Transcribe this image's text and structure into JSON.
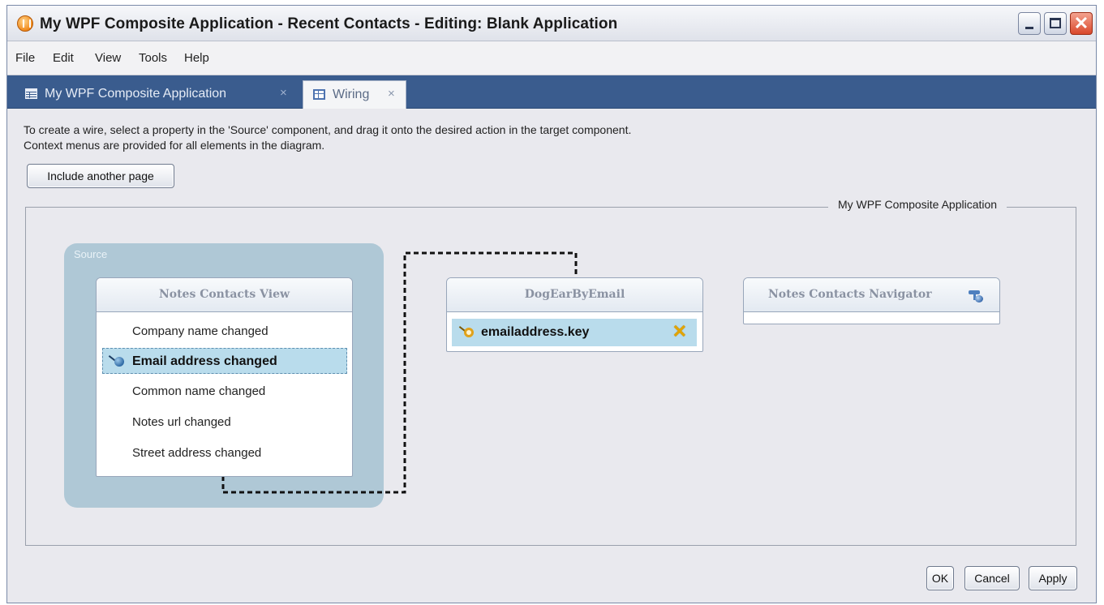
{
  "window": {
    "title": "My WPF Composite Application - Recent Contacts - Editing: Blank Application",
    "icon": "app-orb-icon",
    "controls": [
      "minimize",
      "maximize",
      "close"
    ]
  },
  "menu": {
    "items": [
      "File",
      "Edit",
      "View",
      "Tools",
      "Help"
    ]
  },
  "tabs": [
    {
      "label": "My WPF Composite Application",
      "close": "×",
      "icon": "table-icon",
      "active": false
    },
    {
      "label": "Wiring",
      "close": "×",
      "icon": "layout-icon",
      "active": true
    }
  ],
  "instructions": {
    "line1": "To create a wire, select a property in the 'Source' component, and drag it onto the desired action in the target component.",
    "line2": "Context menus are provided for all elements in the diagram."
  },
  "include_button": "Include another page",
  "diagram": {
    "group_label": "My WPF Composite Application",
    "source_label": "Source",
    "components": [
      {
        "title": "Notes Contacts View",
        "events": [
          {
            "label": "Company name changed",
            "selected": false
          },
          {
            "label": "Email address changed",
            "selected": true
          },
          {
            "label": "Common name changed",
            "selected": false
          },
          {
            "label": "Notes url changed",
            "selected": false
          },
          {
            "label": "Street address changed",
            "selected": false
          }
        ]
      },
      {
        "title": "DogEarByEmail",
        "actions": [
          {
            "label": "emailaddress.key",
            "remove_icon": "close-x-icon"
          }
        ]
      },
      {
        "title": "Notes Contacts Navigator",
        "icon": "navigator-icon",
        "actions": []
      }
    ]
  },
  "footer": {
    "ok": "OK",
    "cancel": "Cancel",
    "apply": "Apply"
  },
  "colors": {
    "tab_bar": "#3a5c8e",
    "source_area": "#afc8d6",
    "selected_row": "#b9dcec",
    "background": "#e9e9ee"
  }
}
